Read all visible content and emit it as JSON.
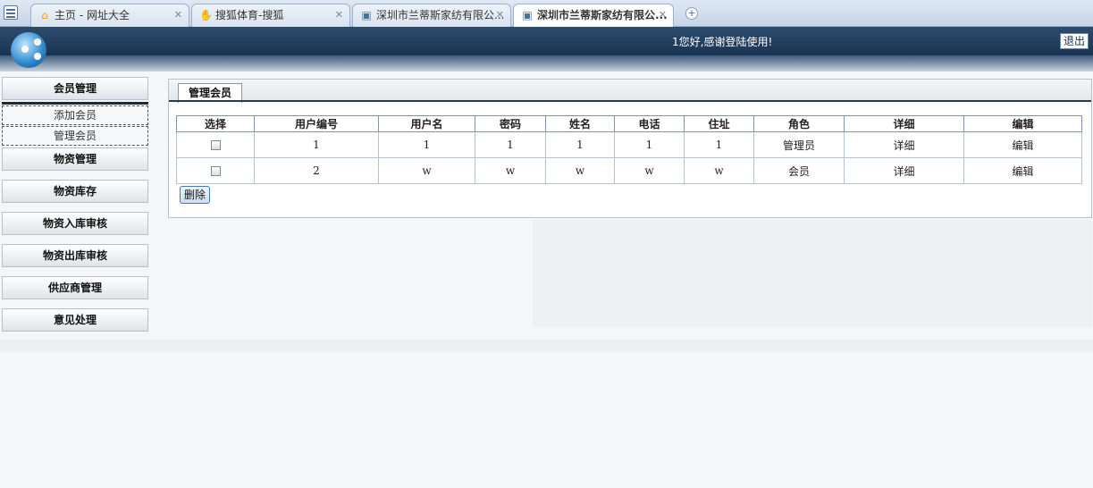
{
  "browser": {
    "tabs": [
      {
        "title": "主页 - 网址大全",
        "icon": "home-icon"
      },
      {
        "title": "搜狐体育-搜狐",
        "icon": "sohu-icon"
      },
      {
        "title": "深圳市兰蒂斯家纺有限公...",
        "icon": "page-icon"
      },
      {
        "title": "深圳市兰蒂斯家纺有限公...",
        "icon": "page-icon"
      }
    ],
    "new_tab": "+"
  },
  "header": {
    "welcome": "1您好,感谢登陆使用!",
    "logout_label": "退出"
  },
  "sidebar": {
    "sections": [
      {
        "label": "会员管理"
      },
      {
        "label": "物资管理"
      },
      {
        "label": "物资库存"
      },
      {
        "label": "物资入库审核"
      },
      {
        "label": "物资出库审核"
      },
      {
        "label": "供应商管理"
      },
      {
        "label": "意见处理"
      }
    ],
    "sub_items": [
      {
        "label": "添加会员"
      },
      {
        "label": "管理会员"
      }
    ]
  },
  "main": {
    "tab_label": "管理会员",
    "columns": [
      "选择",
      "用户编号",
      "用户名",
      "密码",
      "姓名",
      "电话",
      "住址",
      "角色",
      "详细",
      "编辑"
    ],
    "rows": [
      {
        "id": "1",
        "username": "1",
        "password": "1",
        "name": "1",
        "phone": "1",
        "address": "1",
        "role": "管理员",
        "detail": "详细",
        "edit": "编辑"
      },
      {
        "id": "2",
        "username": "w",
        "password": "w",
        "name": "w",
        "phone": "w",
        "address": "w",
        "role": "会员",
        "detail": "详细",
        "edit": "编辑"
      }
    ],
    "delete_label": "删除"
  }
}
